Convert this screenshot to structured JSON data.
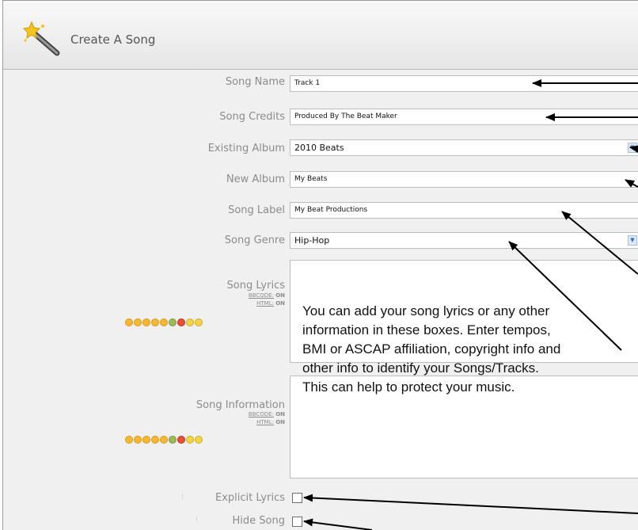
{
  "header": {
    "title": "Create A Song",
    "icon": "magic-wand-icon"
  },
  "form": {
    "song_name": {
      "label": "Song Name",
      "value": "Track 1"
    },
    "song_credits": {
      "label": "Song Credits",
      "value": "Produced By The Beat Maker"
    },
    "existing_album": {
      "label": "Existing Album",
      "selected": "2010 Beats"
    },
    "new_album": {
      "label": "New Album",
      "value": "My Beats"
    },
    "song_label": {
      "label": "Song Label",
      "value": "My Beat Productions"
    },
    "song_genre": {
      "label": "Song Genre",
      "selected": "Hip-Hop"
    },
    "song_lyrics": {
      "label": "Song Lyrics",
      "bbcode": "BBCODE:",
      "bbcode_state": "ON",
      "html": "HTML:",
      "html_state": "ON"
    },
    "song_information": {
      "label": "Song Information",
      "bbcode": "BBCODE:",
      "bbcode_state": "ON",
      "html": "HTML:",
      "html_state": "ON"
    },
    "explicit_lyrics": {
      "label": "Explicit Lyrics",
      "checked": false
    },
    "hide_song": {
      "label": "Hide Song",
      "checked": false
    }
  },
  "callout": {
    "lines": [
      "You can add your song lyrics or any other",
      "information in these boxes. Enter tempos,",
      "BMI or ASCAP affiliation, copyright info and",
      "other info to identify your Songs/Tracks.",
      "This can help to protect your music."
    ]
  },
  "colors": {
    "background": "#f0f0f0",
    "header": "#e9e9e9",
    "label": "#8c8c8c",
    "arrow": "#000000"
  }
}
